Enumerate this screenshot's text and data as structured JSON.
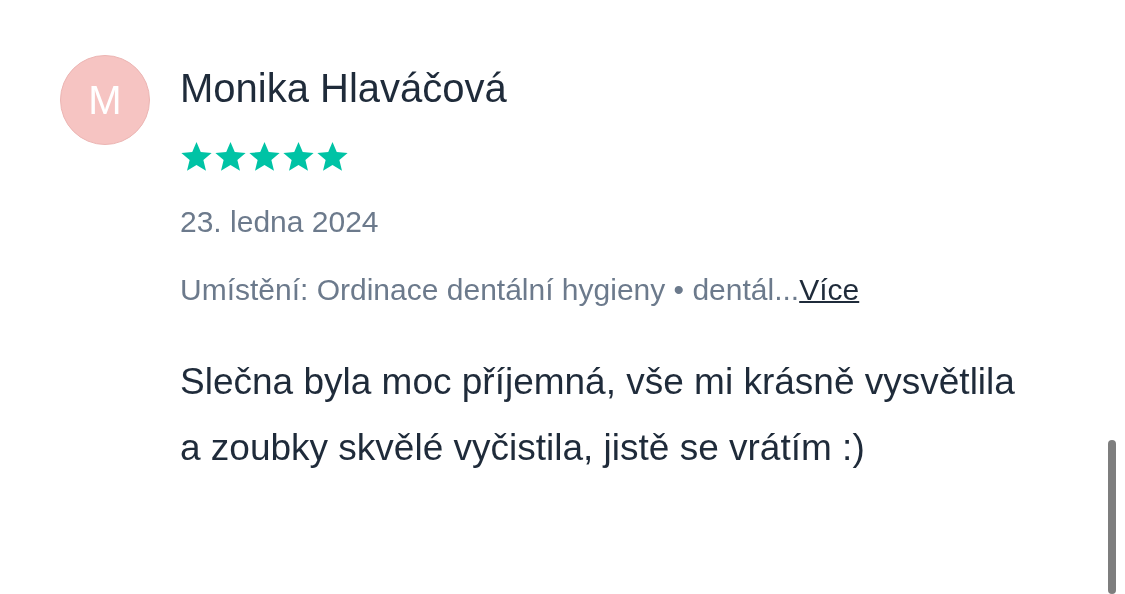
{
  "review": {
    "avatar_initial": "M",
    "author": "Monika Hlaváčová",
    "stars": 5,
    "date": "23. ledna 2024",
    "location": "Umístění: Ordinace dentální hygieny • dentál...",
    "more_link": "Více",
    "text": "Slečna byla moc příjemná, vše mi krásně vysvětlila a zoubky skvělé vyčistila, jistě se vrátím :)"
  }
}
